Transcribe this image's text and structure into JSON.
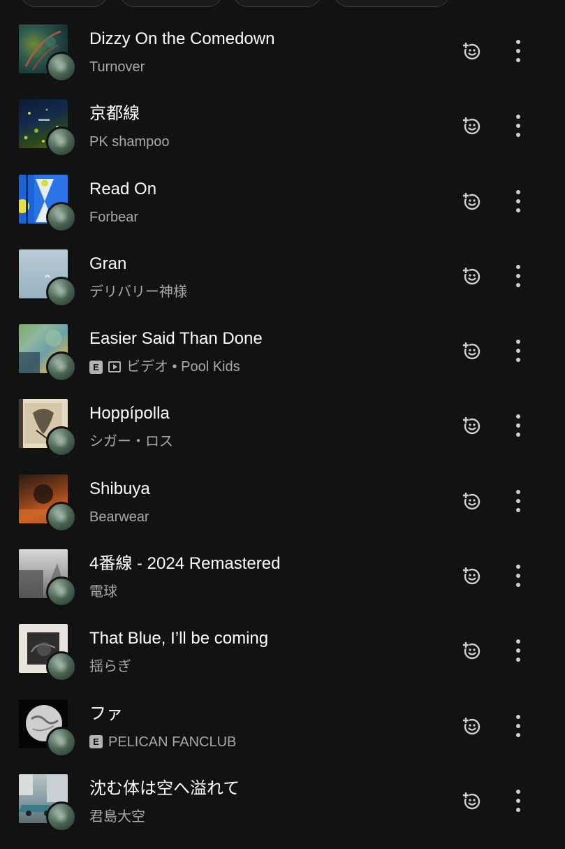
{
  "colors": {
    "background": "#121212",
    "title_text": "#ffffff",
    "subtitle_text": "#a8a8a8",
    "icon": "#d0d0d0"
  },
  "icons": {
    "add_to_mix": "smiley-plus-icon",
    "more": "more-vertical-icon",
    "explicit": "explicit-badge",
    "video": "video-icon"
  },
  "tracks": [
    {
      "title": "Dizzy On the Comedown",
      "artist": "Turnover",
      "explicit": false,
      "video": false,
      "prefix": ""
    },
    {
      "title": "京都線",
      "artist": "PK shampoo",
      "explicit": false,
      "video": false,
      "prefix": ""
    },
    {
      "title": "Read On",
      "artist": "Forbear",
      "explicit": false,
      "video": false,
      "prefix": ""
    },
    {
      "title": "Gran",
      "artist": "デリバリー神様",
      "explicit": false,
      "video": false,
      "prefix": ""
    },
    {
      "title": "Easier Said Than Done",
      "artist": "Pool Kids",
      "explicit": true,
      "video": true,
      "prefix": "ビデオ • "
    },
    {
      "title": "Hoppípolla",
      "artist": "シガー・ロス",
      "explicit": false,
      "video": false,
      "prefix": ""
    },
    {
      "title": "Shibuya",
      "artist": "Bearwear",
      "explicit": false,
      "video": false,
      "prefix": ""
    },
    {
      "title": "4番線 - 2024 Remastered",
      "artist": "電球",
      "explicit": false,
      "video": false,
      "prefix": ""
    },
    {
      "title": "That Blue, I’ll be coming",
      "artist": "揺らぎ",
      "explicit": false,
      "video": false,
      "prefix": ""
    },
    {
      "title": "ファ",
      "artist": "PELICAN FANCLUB",
      "explicit": true,
      "video": false,
      "prefix": ""
    },
    {
      "title": "沈む体は空へ溢れて",
      "artist": "君島大空",
      "explicit": false,
      "video": false,
      "prefix": ""
    }
  ],
  "explicit_label": "E"
}
